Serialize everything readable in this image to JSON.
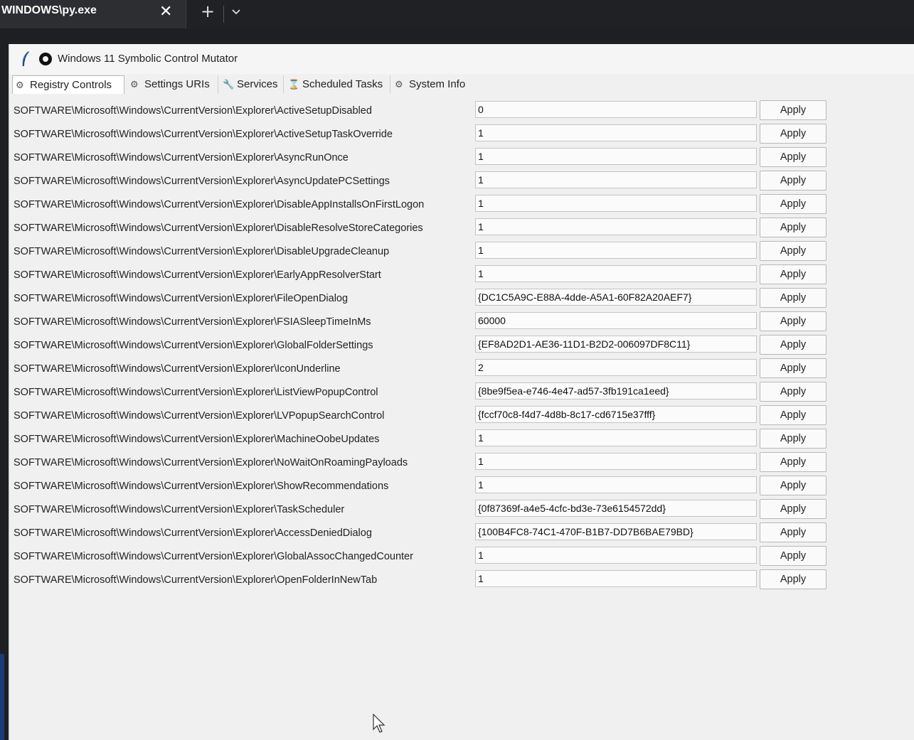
{
  "terminal": {
    "tab_title": "WINDOWS\\py.exe",
    "close_glyph": "✕",
    "new_tab_glyph": "+",
    "dropdown_icon": "chevron-down-icon"
  },
  "app": {
    "title": "Windows 11 Symbolic Control Mutator",
    "icon": "feather-icon"
  },
  "tabs": [
    {
      "label": "Registry Controls",
      "icon": "registry-icon",
      "glyph": "⚙",
      "active": true
    },
    {
      "label": "Settings URIs",
      "icon": "gear-icon",
      "glyph": "⚙",
      "active": false
    },
    {
      "label": "Services",
      "icon": "wrench-icon",
      "glyph": "🔧",
      "active": false
    },
    {
      "label": "Scheduled Tasks",
      "icon": "hourglass-icon",
      "glyph": "⌛",
      "active": false
    },
    {
      "label": "System Info",
      "icon": "info-icon",
      "glyph": "⚙",
      "active": false
    }
  ],
  "apply_label": "Apply",
  "rows": [
    {
      "key": "SOFTWARE\\Microsoft\\Windows\\CurrentVersion\\Explorer\\ActiveSetupDisabled",
      "value": "0",
      "apply": "Apply"
    },
    {
      "key": "SOFTWARE\\Microsoft\\Windows\\CurrentVersion\\Explorer\\ActiveSetupTaskOverride",
      "value": "1",
      "apply": "Apply"
    },
    {
      "key": "SOFTWARE\\Microsoft\\Windows\\CurrentVersion\\Explorer\\AsyncRunOnce",
      "value": "1",
      "apply": "Apply"
    },
    {
      "key": "SOFTWARE\\Microsoft\\Windows\\CurrentVersion\\Explorer\\AsyncUpdatePCSettings",
      "value": "1",
      "apply": "Apply"
    },
    {
      "key": "SOFTWARE\\Microsoft\\Windows\\CurrentVersion\\Explorer\\DisableAppInstallsOnFirstLogon",
      "value": "1",
      "apply": "Apply"
    },
    {
      "key": "SOFTWARE\\Microsoft\\Windows\\CurrentVersion\\Explorer\\DisableResolveStoreCategories",
      "value": "1",
      "apply": "Apply"
    },
    {
      "key": "SOFTWARE\\Microsoft\\Windows\\CurrentVersion\\Explorer\\DisableUpgradeCleanup",
      "value": "1",
      "apply": "Apply"
    },
    {
      "key": "SOFTWARE\\Microsoft\\Windows\\CurrentVersion\\Explorer\\EarlyAppResolverStart",
      "value": "1",
      "apply": "Apply"
    },
    {
      "key": "SOFTWARE\\Microsoft\\Windows\\CurrentVersion\\Explorer\\FileOpenDialog",
      "value": "{DC1C5A9C-E88A-4dde-A5A1-60F82A20AEF7}",
      "apply": "Apply"
    },
    {
      "key": "SOFTWARE\\Microsoft\\Windows\\CurrentVersion\\Explorer\\FSIASleepTimeInMs",
      "value": "60000",
      "apply": "Apply"
    },
    {
      "key": "SOFTWARE\\Microsoft\\Windows\\CurrentVersion\\Explorer\\GlobalFolderSettings",
      "value": "{EF8AD2D1-AE36-11D1-B2D2-006097DF8C11}",
      "apply": "Apply"
    },
    {
      "key": "SOFTWARE\\Microsoft\\Windows\\CurrentVersion\\Explorer\\IconUnderline",
      "value": "2",
      "apply": "Apply"
    },
    {
      "key": "SOFTWARE\\Microsoft\\Windows\\CurrentVersion\\Explorer\\ListViewPopupControl",
      "value": "{8be9f5ea-e746-4e47-ad57-3fb191ca1eed}",
      "apply": "Apply"
    },
    {
      "key": "SOFTWARE\\Microsoft\\Windows\\CurrentVersion\\Explorer\\LVPopupSearchControl",
      "value": "{fccf70c8-f4d7-4d8b-8c17-cd6715e37fff}",
      "apply": "Apply"
    },
    {
      "key": "SOFTWARE\\Microsoft\\Windows\\CurrentVersion\\Explorer\\MachineOobeUpdates",
      "value": "1",
      "apply": "Apply"
    },
    {
      "key": "SOFTWARE\\Microsoft\\Windows\\CurrentVersion\\Explorer\\NoWaitOnRoamingPayloads",
      "value": "1",
      "apply": "Apply"
    },
    {
      "key": "SOFTWARE\\Microsoft\\Windows\\CurrentVersion\\Explorer\\ShowRecommendations",
      "value": "1",
      "apply": "Apply"
    },
    {
      "key": "SOFTWARE\\Microsoft\\Windows\\CurrentVersion\\Explorer\\TaskScheduler",
      "value": "{0f87369f-a4e5-4cfc-bd3e-73e6154572dd}",
      "apply": "Apply"
    },
    {
      "key": "SOFTWARE\\Microsoft\\Windows\\CurrentVersion\\Explorer\\AccessDeniedDialog",
      "value": "{100B4FC8-74C1-470F-B1B7-DD7B6BAE79BD}",
      "apply": "Apply"
    },
    {
      "key": "SOFTWARE\\Microsoft\\Windows\\CurrentVersion\\Explorer\\GlobalAssocChangedCounter",
      "value": "1",
      "apply": "Apply"
    },
    {
      "key": "SOFTWARE\\Microsoft\\Windows\\CurrentVersion\\Explorer\\OpenFolderInNewTab",
      "value": "1",
      "apply": "Apply"
    }
  ]
}
